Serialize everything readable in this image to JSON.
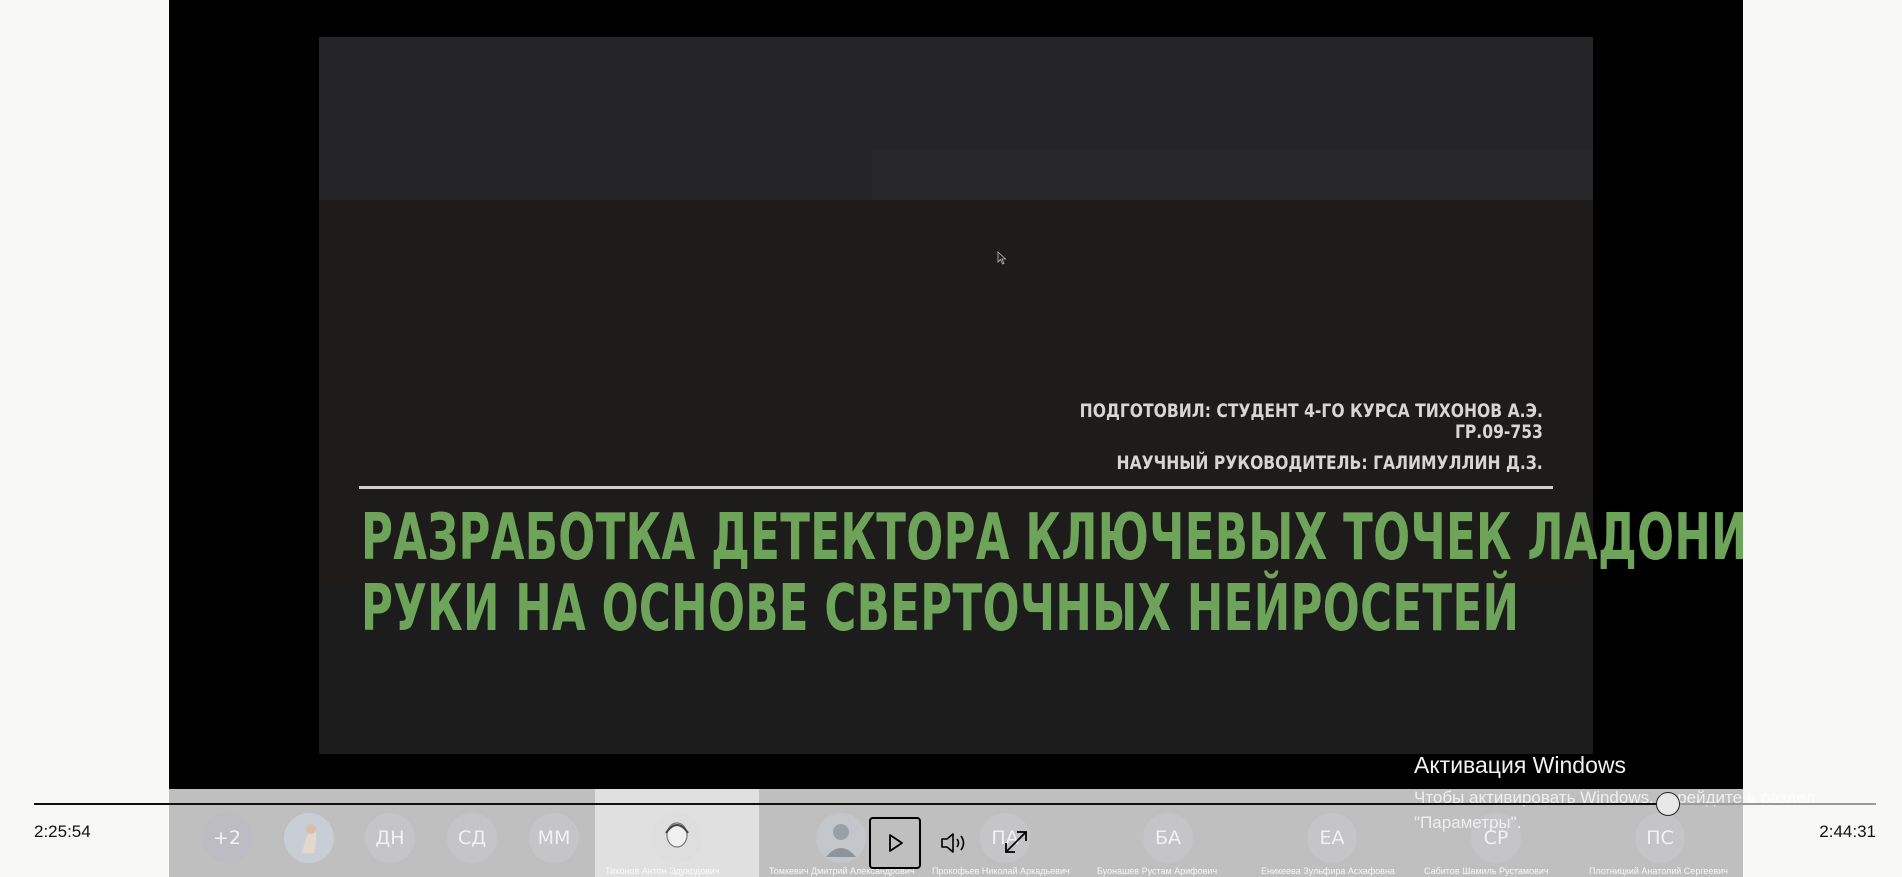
{
  "slide": {
    "author_line1": "ПОДГОТОВИЛ: СТУДЕНТ 4-ГО КУРСА ТИХОНОВ А.Э.",
    "author_line2": "ГР.09-753",
    "supervisor": "НАУЧНЫЙ РУКОВОДИТЕЛЬ: ГАЛИМУЛЛИН Д.З.",
    "title_line1": "РАЗРАБОТКА ДЕТЕКТОРА КЛЮЧЕВЫХ ТОЧЕК ЛАДОНИ",
    "title_line2": "РУКИ НА ОСНОВЕ СВЕРТОЧНЫХ НЕЙРОСЕТЕЙ"
  },
  "participants": {
    "overflow_label": "+2",
    "items": [
      {
        "initials": "",
        "name": ""
      },
      {
        "initials": "ДН",
        "name": ""
      },
      {
        "initials": "СД",
        "name": ""
      },
      {
        "initials": "ММ",
        "name": ""
      },
      {
        "initials": "",
        "name": "Тихонов Антон Эдуардович"
      },
      {
        "initials": "",
        "name": "Томкевич Дмитрий Александрович"
      },
      {
        "initials": "ПА",
        "name": "Прокофьев Николай Аркадьевич"
      },
      {
        "initials": "БА",
        "name": "Буонашев Рустам Арифович"
      },
      {
        "initials": "ЕА",
        "name": "Еникеева Зульфира Асхафовна"
      },
      {
        "initials": "СР",
        "name": "Сабитов Шамиль Рустамович"
      },
      {
        "initials": "ПС",
        "name": "Плотницкий Анатолий Сергеевич"
      }
    ]
  },
  "player": {
    "current_time": "2:25:54",
    "total_time": "2:44:31",
    "progress_fraction": 0.887
  },
  "watermark": {
    "title": "Активация Windows",
    "line1": "Чтобы активировать Windows, перейдите в раздел",
    "line2": "\"Параметры\"."
  }
}
